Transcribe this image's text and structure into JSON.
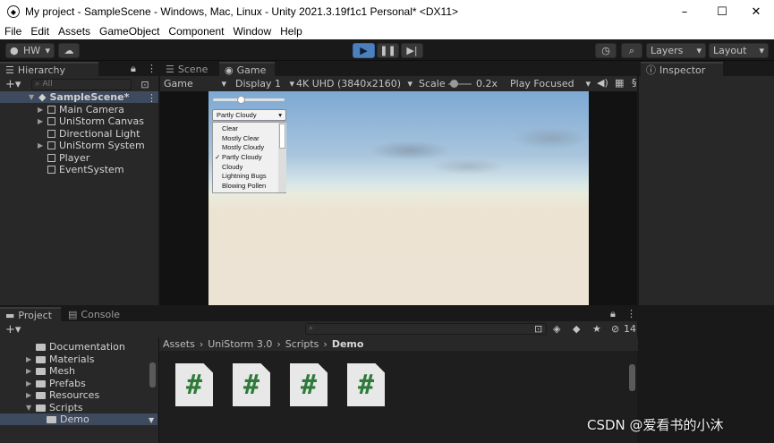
{
  "window": {
    "title": "My project - SampleScene - Windows, Mac, Linux - Unity 2021.3.19f1c1 Personal* <DX11>",
    "minimize": "–",
    "maximize": "☐",
    "close": "✕"
  },
  "menu": [
    "File",
    "Edit",
    "Assets",
    "GameObject",
    "Component",
    "Window",
    "Help"
  ],
  "toolbar": {
    "account": "HW",
    "layers": "Layers",
    "layout": "Layout"
  },
  "hierarchy": {
    "tab": "Hierarchy",
    "search_placeholder": "All",
    "scene": "SampleScene*",
    "items": [
      "Main Camera",
      "UniStorm Canvas",
      "Directional Light",
      "UniStorm System",
      "Player",
      "EventSystem"
    ]
  },
  "tabs": {
    "scene": "Scene",
    "game": "Game",
    "inspector": "Inspector",
    "project": "Project",
    "console": "Console"
  },
  "game": {
    "mode": "Game",
    "display": "Display 1",
    "resolution": "4K UHD (3840x2160)",
    "scale_label": "Scale",
    "scale_value": "0.2x",
    "play": "Play Focused",
    "weather_selected": "Partly Cloudy",
    "weather_options": [
      "Clear",
      "Mostly Clear",
      "Mostly Cloudy",
      "Partly Cloudy",
      "Cloudy",
      "Lightning Bugs",
      "Blowing Pollen"
    ]
  },
  "project": {
    "folders": [
      "Documentation",
      "Materials",
      "Mesh",
      "Prefabs",
      "Resources",
      "Scripts",
      "Demo"
    ],
    "breadcrumb": [
      "Assets",
      "UniStorm 3.0",
      "Scripts",
      "Demo"
    ],
    "count": "14",
    "script_glyph": "#"
  },
  "watermark": "CSDN @爱看书的小沐"
}
